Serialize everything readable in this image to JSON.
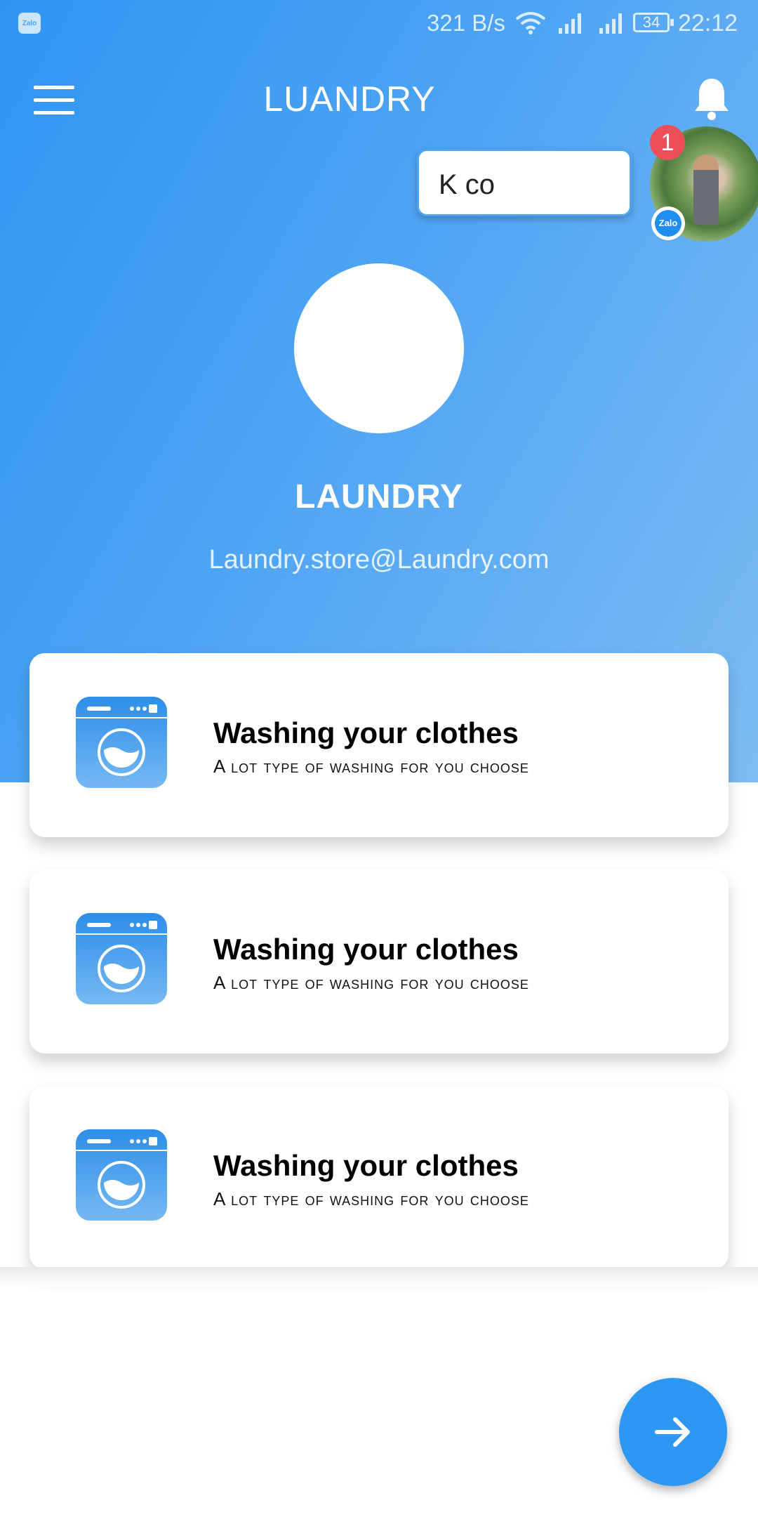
{
  "status_bar": {
    "app_icon_label": "Zalo",
    "net_speed": "321 B/s",
    "battery": "34",
    "time": "22:12"
  },
  "app_bar": {
    "title": "LUANDRY"
  },
  "chat_head": {
    "message": "K co",
    "unread_count": "1",
    "badge_label": "Zalo"
  },
  "profile": {
    "name": "LAUNDRY",
    "email": "Laundry.store@Laundry.com"
  },
  "services": [
    {
      "title": "Washing your clothes",
      "subtitle": "A lot type of washing for you choose",
      "icon": "washing-machine-icon"
    },
    {
      "title": "Washing your clothes",
      "subtitle": "A lot type of washing for you choose",
      "icon": "washing-machine-icon"
    },
    {
      "title": "Washing your clothes",
      "subtitle": "A lot type of washing for you choose",
      "icon": "washing-machine-icon"
    }
  ],
  "fab": {
    "icon": "arrow-right-icon"
  },
  "colors": {
    "primary": "#2d97f4",
    "gradient_start": "#2f95f2",
    "gradient_end": "#7dbcf2",
    "badge_red": "#ec4f58"
  }
}
